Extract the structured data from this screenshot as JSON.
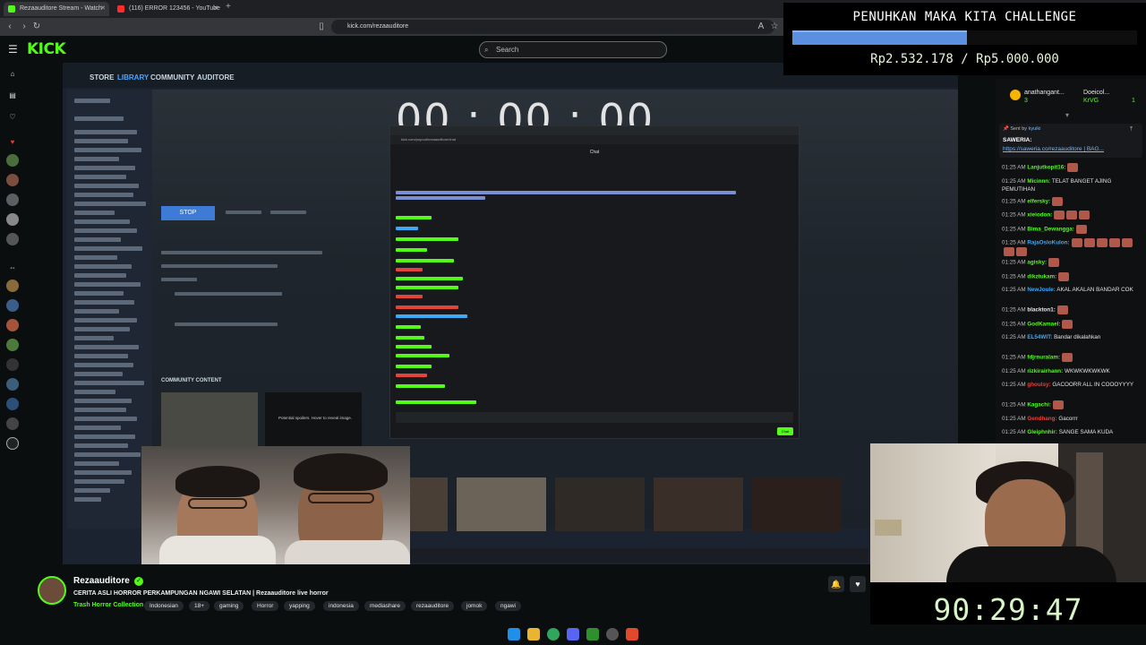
{
  "browser": {
    "tabs": [
      {
        "title": "Rezaauditore Stream - Watch",
        "favicon_color": "#53fc18"
      },
      {
        "title": "(116) ERROR 123456 - YouTube",
        "favicon_color": "#ff2a2a"
      }
    ],
    "new_tab_icon": "plus-icon",
    "url": "kick.com/rezaauditore"
  },
  "kick": {
    "logo": "KICK",
    "search_placeholder": "Search"
  },
  "stream_scene": {
    "steam_nav": [
      "STORE",
      "LIBRARY",
      "COMMUNITY",
      "AUDITORE"
    ],
    "stop_label": "STOP",
    "community_content": "COMMUNITY CONTENT",
    "spoiler_text": "Potential spoilers. Hover to reveal image.",
    "big_timer": "00 : 00 : 00",
    "popout_title": "Chat",
    "popout_url": "kick.com/popout/rezaauditore/chat",
    "popout_send": "Chat"
  },
  "goal": {
    "title": "PENUHKAN MAKA KITA CHALLENGE",
    "progress_fraction": 0.506,
    "current": "Rp2.532.178",
    "target": "Rp5.000.000",
    "text": "Rp2.532.178 / Rp5.000.000"
  },
  "chat": {
    "top_gifter_1": "anathangant...",
    "top_gifter_1_count": "3",
    "top_gifter_2": "Doeicol...",
    "top_gifter_2_count": "1",
    "top_gifter_3": "KrVG",
    "pinned_sender": "Sent by",
    "pinned_user": "kyuiki",
    "pinned_label": "SAWERIA:",
    "pinned_link": "https://saweria.co/rezaauditore | BAG...",
    "messages": [
      {
        "time": "01:25 AM",
        "user": "Lanjutkopit16:",
        "color": "#53fc18",
        "text": "",
        "emotes": 1
      },
      {
        "time": "01:25 AM",
        "user": "Micinnn:",
        "color": "#53fc18",
        "text": "TELAT BANGET AJING PEMUTIHAN",
        "emotes": 0
      },
      {
        "time": "01:25 AM",
        "user": "elfersky:",
        "color": "#53fc18",
        "text": "",
        "emotes": 1
      },
      {
        "time": "01:25 AM",
        "user": "xieiodon:",
        "color": "#53fc18",
        "text": "",
        "emotes": 3
      },
      {
        "time": "01:25 AM",
        "user": "Bima_Dewangga:",
        "color": "#53fc18",
        "text": "",
        "emotes": 1
      },
      {
        "time": "01:25 AM",
        "user": "RajaOsloKulon:",
        "color": "#3fa9f5",
        "text": "",
        "emotes": 7
      },
      {
        "time": "01:25 AM",
        "user": "agisky:",
        "color": "#53fc18",
        "text": "",
        "emotes": 1
      },
      {
        "time": "01:25 AM",
        "user": "dikztukam:",
        "color": "#53fc18",
        "text": "",
        "emotes": 1
      },
      {
        "time": "01:25 AM",
        "user": "NewJoule:",
        "color": "#3fa9f5",
        "text": "AKAL AKALAN BANDAR COK",
        "emotes": 0
      },
      {
        "time": "01:25 AM",
        "user": "blackton1:",
        "color": "#e8e8e8",
        "text": "",
        "emotes": 1
      },
      {
        "time": "01:25 AM",
        "user": "GodKamael:",
        "color": "#53fc18",
        "text": "",
        "emotes": 1
      },
      {
        "time": "01:25 AM",
        "user": "EL54WIT:",
        "color": "#3fa9f5",
        "text": "Bandar dikalahkan",
        "emotes": 0
      },
      {
        "time": "01:25 AM",
        "user": "fdjrnuralam:",
        "color": "#53fc18",
        "text": "",
        "emotes": 1
      },
      {
        "time": "01:25 AM",
        "user": "rizkirairhann:",
        "color": "#53fc18",
        "text": "WKWKWKWKWK",
        "emotes": 0
      },
      {
        "time": "01:25 AM",
        "user": "ghoulsy:",
        "color": "#e0443b",
        "text": "GACOORR ALL IN COOOYYYY",
        "emotes": 0
      },
      {
        "time": "01:25 AM",
        "user": "Kagachi:",
        "color": "#53fc18",
        "text": "",
        "emotes": 1
      },
      {
        "time": "01:25 AM",
        "user": "Gendhang:",
        "color": "#e0443b",
        "text": "Gacorrr",
        "emotes": 0
      },
      {
        "time": "01:25 AM",
        "user": "Gleiphnhir:",
        "color": "#53fc18",
        "text": "SANGE SAMA KUDA",
        "emotes": 0
      }
    ]
  },
  "timer2": "90:29:47",
  "stream_info": {
    "streamer": "Rezaauditore",
    "title": "CERITA ASLI HORROR PERKAMPUNGAN NGAWI SELATAN | Rezaauditore live horror",
    "category": "Trash Horror Collection",
    "tags": [
      "Indonesian",
      "18+",
      "gaming",
      "Horror",
      "yapping",
      "indonesia",
      "mediashare",
      "rezaauditore",
      "jomok",
      "ngawi"
    ]
  }
}
